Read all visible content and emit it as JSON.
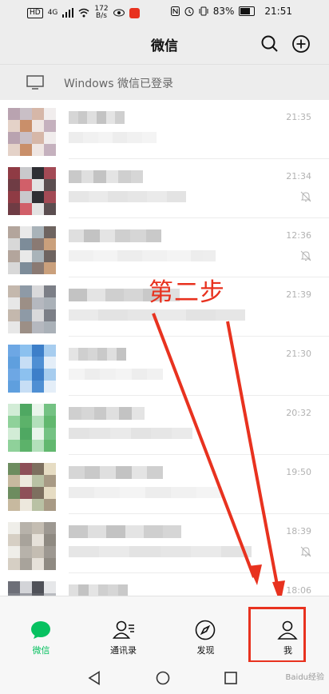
{
  "status_bar": {
    "left_tags": [
      "HD",
      "4G"
    ],
    "speed_value": "172",
    "speed_unit": "B/s",
    "battery": "83%",
    "battery_level": 0.83,
    "time": "21:51"
  },
  "header": {
    "title": "微信",
    "search_icon": "search-icon",
    "add_icon": "plus-circle-icon"
  },
  "pc_login": {
    "text": "Windows 微信已登录",
    "icon": "monitor-icon"
  },
  "chats": [
    {
      "time": "21:35",
      "muted": false,
      "colors": [
        "#b9a3b0",
        "#c98f6a",
        "#d6b7a8",
        "#c5b1be",
        "#e4d2c8",
        "#c9bfc6",
        "#efe6e3",
        "#f1eded"
      ]
    },
    {
      "time": "21:34",
      "muted": true,
      "colors": [
        "#a34a55",
        "#8f3b44",
        "#d15f69",
        "#2e2e33",
        "#5b4e50",
        "#6f3c44",
        "#c9c9cc",
        "#e3e3e3"
      ]
    },
    {
      "time": "12:36",
      "muted": true,
      "colors": [
        "#8a7a73",
        "#6e6460",
        "#b3a59c",
        "#7d8c99",
        "#a9b3b9",
        "#caa07c",
        "#d8d8d8",
        "#e9e9e9"
      ]
    },
    {
      "time": "21:39",
      "muted": false,
      "colors": [
        "#8e9aa6",
        "#b5b8bf",
        "#7c7f87",
        "#c4b8ad",
        "#9c8f86",
        "#d9d9db",
        "#aab1b8",
        "#e7e7e7"
      ]
    },
    {
      "time": "21:30",
      "muted": false,
      "colors": [
        "#5f9fde",
        "#8cc1ef",
        "#4f8fd3",
        "#a7cdef",
        "#6da7e4",
        "#c7def5",
        "#3d7fc9",
        "#e4eef8"
      ]
    },
    {
      "time": "20:32",
      "muted": false,
      "colors": [
        "#62b86f",
        "#8fd19a",
        "#4fa862",
        "#b3e0bb",
        "#74c283",
        "#d2ecd6",
        "#5cb26a",
        "#e9f5eb"
      ]
    },
    {
      "time": "19:50",
      "muted": false,
      "colors": [
        "#7d6f5f",
        "#a89a85",
        "#c7b99f",
        "#8e4f58",
        "#b9c1a4",
        "#e6dcc3",
        "#6d8c5f",
        "#ede8dd"
      ]
    },
    {
      "time": "18:39",
      "muted": true,
      "colors": [
        "#a8a39b",
        "#c4bdb2",
        "#8f8a82",
        "#d6cfc4",
        "#b7b2aa",
        "#e6e1d9",
        "#9d9891",
        "#efeee9"
      ]
    },
    {
      "time": "18:06",
      "muted": false,
      "colors": [
        "#6d6f78",
        "#9a9ca3",
        "#4f5158",
        "#b9bbc0",
        "#80838a",
        "#d3d4d8",
        "#5f6168",
        "#e6e7e9"
      ]
    }
  ],
  "annotation": {
    "text": "第二步"
  },
  "tabs": [
    {
      "label": "微信",
      "icon": "chat-bubble-icon",
      "active": true
    },
    {
      "label": "通讯录",
      "icon": "contacts-icon",
      "active": false
    },
    {
      "label": "发现",
      "icon": "compass-icon",
      "active": false
    },
    {
      "label": "我",
      "icon": "person-icon",
      "active": false
    }
  ],
  "system_nav": {
    "back": "back-triangle-icon",
    "home": "home-circle-icon",
    "recents": "recents-square-icon"
  },
  "watermark": "Baidu经验",
  "colors": {
    "accent": "#07c160",
    "annotation": "#e8321f",
    "background": "#ededed"
  }
}
